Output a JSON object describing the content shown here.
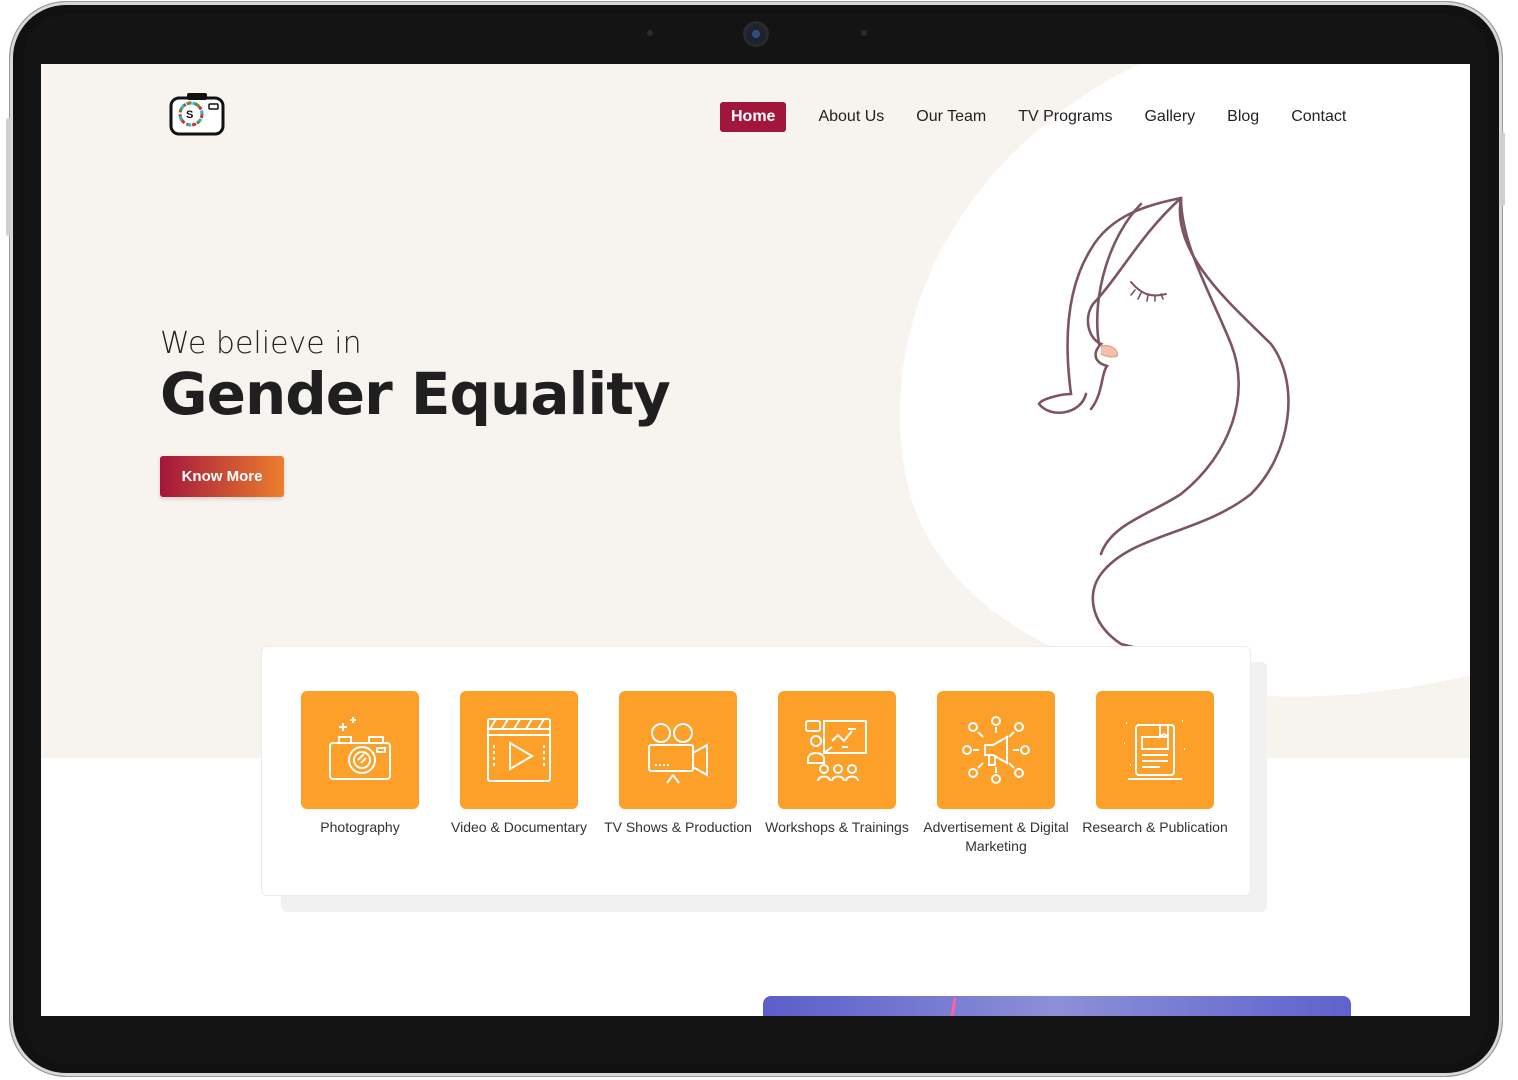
{
  "nav": {
    "items": [
      "Home",
      "About Us",
      "Our Team",
      "TV Programs",
      "Gallery",
      "Blog",
      "Contact"
    ],
    "active": "Home"
  },
  "hero": {
    "pre_title": "We believe in",
    "title": "Gender Equality",
    "cta_label": "Know More"
  },
  "services": [
    {
      "label": "Photography",
      "icon": "camera-icon"
    },
    {
      "label": "Video & Documentary",
      "icon": "video-player-icon"
    },
    {
      "label": "TV Shows & Production",
      "icon": "video-camera-icon"
    },
    {
      "label": "Workshops & Trainings",
      "icon": "presentation-icon"
    },
    {
      "label": "Advertisement & Digital Marketing",
      "icon": "megaphone-icon"
    },
    {
      "label": "Research & Publication",
      "icon": "book-icon"
    }
  ],
  "colors": {
    "brand_primary": "#a3163c",
    "accent_orange": "#fca02a",
    "hero_background": "#f7f4ef"
  }
}
